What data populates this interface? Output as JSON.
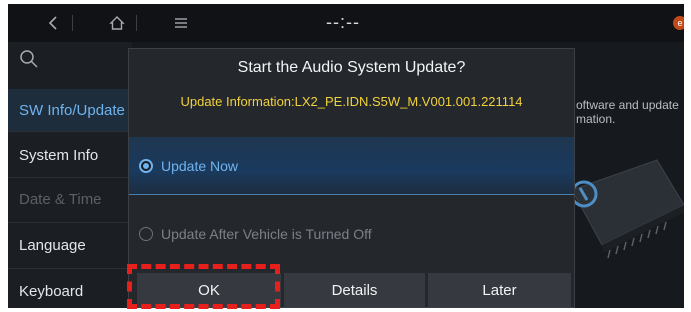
{
  "topbar": {
    "back_icon": "chevron-left-icon",
    "home_icon": "home-icon",
    "menu_icon": "menu-icon",
    "clock": "--:--",
    "status_icon": "notification-icon"
  },
  "sidebar": {
    "search_icon": "search-icon",
    "items": [
      {
        "label": "SW Info/Update",
        "state": "active"
      },
      {
        "label": "System Info",
        "state": "normal"
      },
      {
        "label": "Date & Time",
        "state": "disabled"
      },
      {
        "label": "Language",
        "state": "normal"
      },
      {
        "label": "Keyboard",
        "state": "normal"
      }
    ]
  },
  "background": {
    "text_line1": "oftware and update",
    "text_line2": "mation."
  },
  "dialog": {
    "title": "Start the Audio System Update?",
    "info": "Update Information:LX2_PE.IDN.S5W_M.V001.001.221114",
    "options": [
      {
        "label": "Update Now",
        "selected": true
      },
      {
        "label": "Update After Vehicle is Turned Off",
        "selected": false
      }
    ],
    "buttons": {
      "ok": "OK",
      "details": "Details",
      "later": "Later"
    }
  },
  "colors": {
    "accent": "#6fb3ee",
    "info": "#f2d23c",
    "highlight": "#e8201c"
  }
}
